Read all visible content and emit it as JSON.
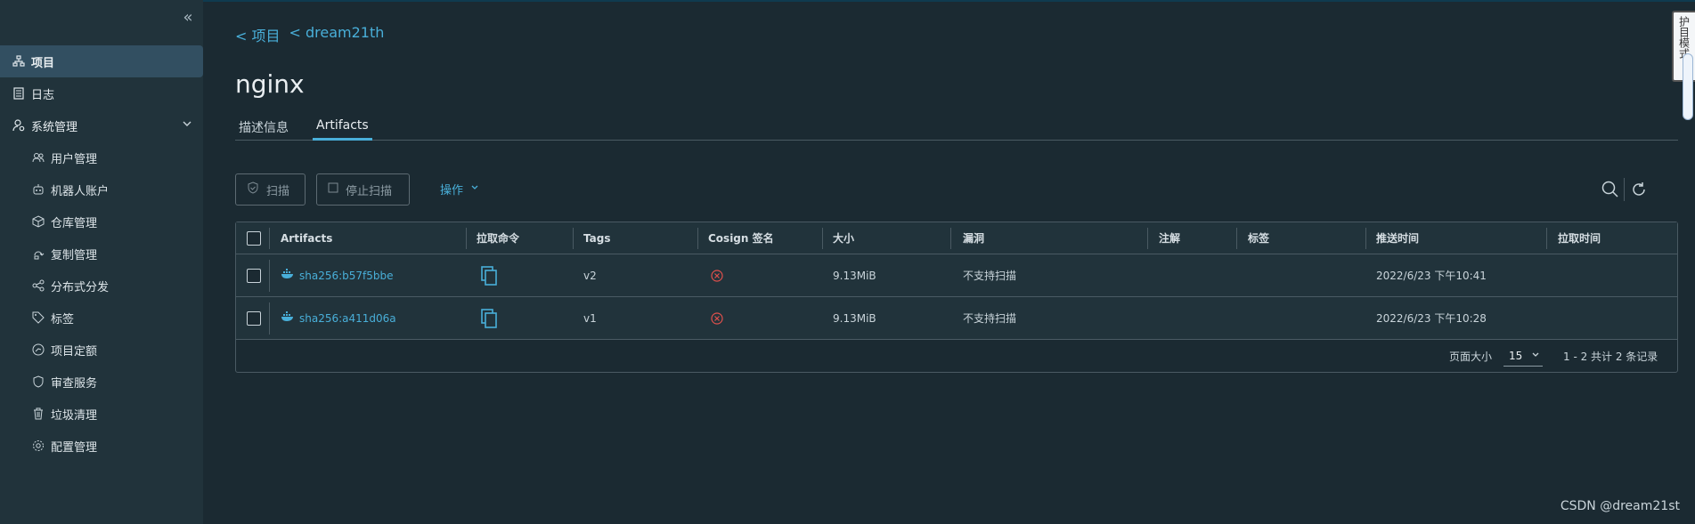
{
  "sidebar": {
    "collapse_icon": "«",
    "items": [
      {
        "label": "项目",
        "icon": "project-icon",
        "active": true
      },
      {
        "label": "日志",
        "icon": "log-icon"
      },
      {
        "label": "系统管理",
        "icon": "admin-icon",
        "expanded": true
      },
      {
        "label": "用户管理",
        "icon": "users-icon",
        "sub": true
      },
      {
        "label": "机器人账户",
        "icon": "robot-icon",
        "sub": true
      },
      {
        "label": "仓库管理",
        "icon": "registry-icon",
        "sub": true
      },
      {
        "label": "复制管理",
        "icon": "replication-icon",
        "sub": true
      },
      {
        "label": "分布式分发",
        "icon": "distribution-icon",
        "sub": true
      },
      {
        "label": "标签",
        "icon": "tag-icon",
        "sub": true
      },
      {
        "label": "项目定额",
        "icon": "quota-icon",
        "sub": true
      },
      {
        "label": "审查服务",
        "icon": "shield-icon",
        "sub": true
      },
      {
        "label": "垃圾清理",
        "icon": "trash-icon",
        "sub": true
      },
      {
        "label": "配置管理",
        "icon": "gear-icon",
        "sub": true
      }
    ]
  },
  "breadcrumb": [
    "< 项目",
    "< dream21th"
  ],
  "page_title": "nginx",
  "tabs": [
    "描述信息",
    "Artifacts"
  ],
  "active_tab": "Artifacts",
  "toolbar": {
    "scan_label": "扫描",
    "stop_scan_label": "停止扫描",
    "actions_label": "操作"
  },
  "table": {
    "columns": [
      "Artifacts",
      "拉取命令",
      "Tags",
      "Cosign 签名",
      "大小",
      "漏洞",
      "注解",
      "标签",
      "推送时间",
      "拉取时间"
    ],
    "rows": [
      {
        "artifact": "sha256:b57f5bbe",
        "tags": "v2",
        "size": "9.13MiB",
        "vulnerability": "不支持扫描",
        "push_time": "2022/6/23 下午10:41",
        "pull_time": ""
      },
      {
        "artifact": "sha256:a411d06a",
        "tags": "v1",
        "size": "9.13MiB",
        "vulnerability": "不支持扫描",
        "push_time": "2022/6/23 下午10:28",
        "pull_time": ""
      }
    ],
    "footer": {
      "page_size_label": "页面大小",
      "page_size": "15",
      "summary": "1 - 2 共计 2 条记录"
    }
  },
  "side_widget_text": "护目模式",
  "watermark": "CSDN @dream21st",
  "colors": {
    "accent": "#49afd9",
    "error": "#e0504c",
    "sidebar_bg": "#21333b",
    "bg": "#1b2a32"
  }
}
